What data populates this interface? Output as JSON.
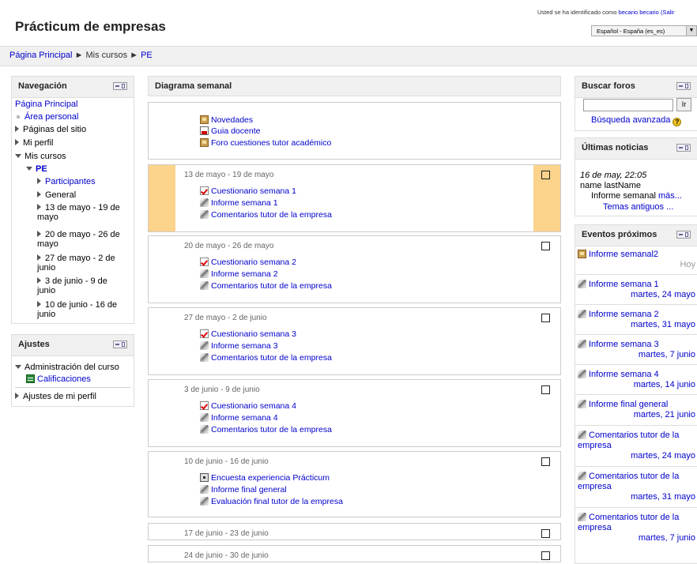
{
  "header": {
    "site_title": "Prácticum de empresas",
    "login_prefix": "Usted se ha identificado como ",
    "login_user": "becario becario",
    "login_logout": "(Salir",
    "language": "Español - España (es_es)"
  },
  "breadcrumb": {
    "items": [
      "Página Principal",
      "Mis cursos",
      "PE"
    ],
    "separator": "►"
  },
  "navigation": {
    "title": "Navegación",
    "home": "Página Principal",
    "area_personal": "Área personal",
    "site_pages": "Páginas del sitio",
    "my_profile": "Mi perfil",
    "my_courses": "Mis cursos",
    "course": "PE",
    "participants": "Participantes",
    "general": "General",
    "weeks": [
      "13 de mayo - 19 de mayo",
      "20 de mayo - 26 de mayo",
      "27 de mayo - 2 de junio",
      "3 de junio - 9 de junio",
      "10 de junio - 16 de junio"
    ]
  },
  "settings": {
    "title": "Ajustes",
    "course_admin": "Administración del curso",
    "grades": "Calificaciones",
    "profile_settings": "Ajustes de mi perfil"
  },
  "main": {
    "title": "Diagrama semanal",
    "intro_activities": [
      {
        "icon": "forum-icon",
        "label": "Novedades"
      },
      {
        "icon": "pdf-icon",
        "label": "Guia docente"
      },
      {
        "icon": "forum-icon",
        "label": "Foro cuestiones tutor académico"
      }
    ],
    "sections": [
      {
        "title": "13 de mayo - 19 de mayo",
        "current": true,
        "activities": [
          {
            "icon": "quiz-icon",
            "label": "Cuestionario semana 1"
          },
          {
            "icon": "assignment-icon",
            "label": "Informe semana 1"
          },
          {
            "icon": "assignment-icon",
            "label": "Comentarios tutor de la empresa"
          }
        ]
      },
      {
        "title": "20 de mayo - 26 de mayo",
        "current": false,
        "activities": [
          {
            "icon": "quiz-icon",
            "label": "Cuestionario semana 2"
          },
          {
            "icon": "assignment-icon",
            "label": "Informe semana 2"
          },
          {
            "icon": "assignment-icon",
            "label": "Comentarios tutor de la empresa"
          }
        ]
      },
      {
        "title": "27 de mayo - 2 de junio",
        "current": false,
        "activities": [
          {
            "icon": "quiz-icon",
            "label": "Cuestionario semana 3"
          },
          {
            "icon": "assignment-icon",
            "label": "Informe semana 3"
          },
          {
            "icon": "assignment-icon",
            "label": "Comentarios tutor de la empresa"
          }
        ]
      },
      {
        "title": "3 de junio - 9 de junio",
        "current": false,
        "activities": [
          {
            "icon": "quiz-icon",
            "label": "Cuestionario semana 4"
          },
          {
            "icon": "assignment-icon",
            "label": "Informe semana 4"
          },
          {
            "icon": "assignment-icon",
            "label": "Comentarios tutor de la empresa"
          }
        ]
      },
      {
        "title": "10 de junio - 16 de junio",
        "current": false,
        "activities": [
          {
            "icon": "feedback-icon",
            "label": "Encuesta experiencia Prácticum"
          },
          {
            "icon": "assignment-icon",
            "label": "Informe final general"
          },
          {
            "icon": "assignment-icon",
            "label": "Evaluación final tutor de la empresa"
          }
        ]
      },
      {
        "title": "17 de junio - 23 de junio",
        "current": false,
        "activities": []
      },
      {
        "title": "24 de junio - 30 de junio",
        "current": false,
        "activities": []
      }
    ]
  },
  "search_forums": {
    "title": "Buscar foros",
    "go_label": "Ir",
    "advanced": "Búsqueda avanzada",
    "help_glyph": "?"
  },
  "news": {
    "title": "Últimas noticias",
    "date": "16 de may, 22:05",
    "author": "name lastName",
    "subject": "Informe semanal",
    "more": "más...",
    "older": "Temas antiguos ..."
  },
  "events": {
    "title": "Eventos próximos",
    "items": [
      {
        "icon": "forum-icon",
        "name": "Informe semanal2",
        "date": "Hoy",
        "date_muted": true
      },
      {
        "icon": "assignment-icon",
        "name": "Informe semana 1",
        "date": "martes, 24 mayo"
      },
      {
        "icon": "assignment-icon",
        "name": "Informe semana 2",
        "date": "martes, 31 mayo"
      },
      {
        "icon": "assignment-icon",
        "name": "Informe semana 3",
        "date": "martes, 7 junio"
      },
      {
        "icon": "assignment-icon",
        "name": "Informe semana 4",
        "date": "martes, 14 junio"
      },
      {
        "icon": "assignment-icon",
        "name": "Informe final general",
        "date": "martes, 21 junio"
      },
      {
        "icon": "assignment-icon",
        "name": "Comentarios tutor de la empresa",
        "date": "martes, 24 mayo"
      },
      {
        "icon": "assignment-icon",
        "name": "Comentarios tutor de la empresa",
        "date": "martes, 31 mayo"
      },
      {
        "icon": "assignment-icon",
        "name": "Comentarios tutor de la empresa",
        "date": "martes, 7 junio"
      }
    ]
  },
  "colors": {
    "link": "#0000cc",
    "current_week": "#fbd38b",
    "block_header": "#f0f0f0"
  }
}
